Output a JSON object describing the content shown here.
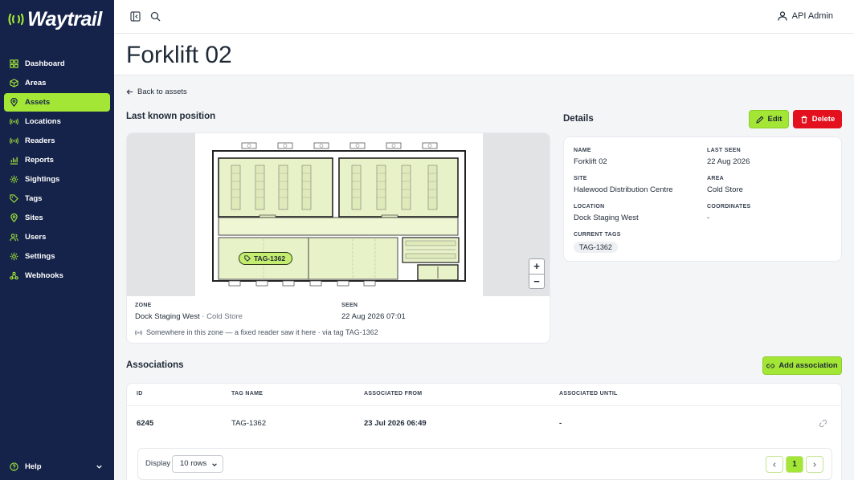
{
  "app": {
    "name": "Waytrail"
  },
  "colors": {
    "sidebar": "#15234a",
    "accent": "#a3e635",
    "danger": "#e3101d"
  },
  "sidebar": {
    "items": [
      {
        "label": "Dashboard",
        "icon": "grid-icon"
      },
      {
        "label": "Areas",
        "icon": "cube-icon"
      },
      {
        "label": "Assets",
        "icon": "pin-icon",
        "active": true
      },
      {
        "label": "Locations",
        "icon": "signal-icon"
      },
      {
        "label": "Readers",
        "icon": "signal-icon"
      },
      {
        "label": "Reports",
        "icon": "chart-icon"
      },
      {
        "label": "Sightings",
        "icon": "gear-icon"
      },
      {
        "label": "Tags",
        "icon": "tag-icon"
      },
      {
        "label": "Sites",
        "icon": "pin-icon"
      },
      {
        "label": "Users",
        "icon": "users-icon"
      },
      {
        "label": "Settings",
        "icon": "gear-icon"
      },
      {
        "label": "Webhooks",
        "icon": "webhook-icon"
      }
    ],
    "help_label": "Help"
  },
  "topbar": {
    "user_name": "API Admin"
  },
  "page": {
    "title": "Forklift 02",
    "back_label": "Back to assets"
  },
  "position": {
    "heading": "Last known position",
    "tag_label": "TAG-1362",
    "zoom_in": "+",
    "zoom_out": "−",
    "zone_label": "ZONE",
    "zone_value": "Dock Staging West",
    "zone_sep": " · ",
    "zone_area": "Cold Store",
    "seen_label": "SEEN",
    "seen_value": "22 Aug 2026 07:01",
    "note": "Somewhere in this zone — a fixed reader saw it here · via tag TAG-1362"
  },
  "details": {
    "heading": "Details",
    "edit_label": "Edit",
    "delete_label": "Delete",
    "fields": {
      "name_label": "NAME",
      "name_value": "Forklift 02",
      "last_seen_label": "LAST SEEN",
      "last_seen_value": "22 Aug 2026",
      "site_label": "SITE",
      "site_value": "Halewood Distribution Centre",
      "area_label": "AREA",
      "area_value": "Cold Store",
      "location_label": "LOCATION",
      "location_value": "Dock Staging West",
      "coordinates_label": "COORDINATES",
      "coordinates_value": "-",
      "tags_label": "CURRENT TAGS",
      "tags_value": "TAG-1362"
    }
  },
  "associations": {
    "heading": "Associations",
    "add_label": "Add association",
    "columns": [
      "ID",
      "TAG NAME",
      "ASSOCIATED FROM",
      "ASSOCIATED UNTIL"
    ],
    "rows": [
      {
        "id": "6245",
        "tag": "TAG-1362",
        "from": "23 Jul 2026 06:49",
        "until": "-"
      }
    ],
    "display_label": "Display",
    "rows_option": "10 rows",
    "current_page": "1"
  }
}
